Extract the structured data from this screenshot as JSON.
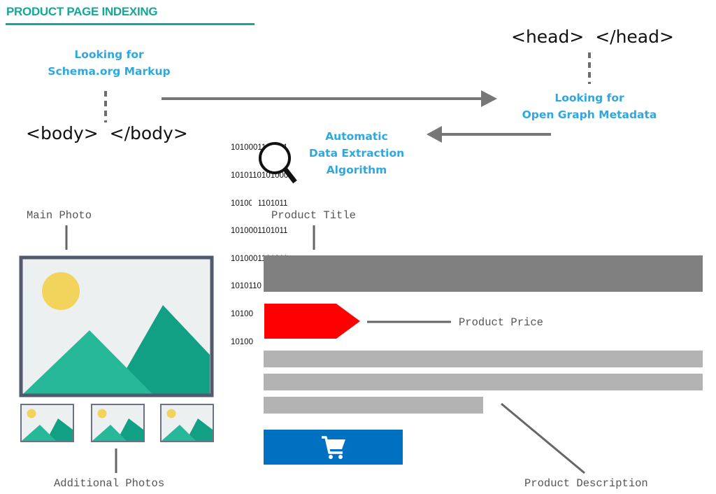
{
  "header": {
    "title": "PRODUCT PAGE INDEXING"
  },
  "labels": {
    "schema": [
      "Looking for",
      "Schema.org Markup"
    ],
    "open_graph": [
      "Looking for",
      "Open Graph Metadata"
    ],
    "algorithm": [
      "Automatic",
      "Data Extraction",
      "Algorithm"
    ]
  },
  "tags": {
    "body": "<body>  </body>",
    "head": "<head>  </head>"
  },
  "binary_lines": [
    "1010001101011",
    "1010110101000",
    "1010001101011",
    "1010001101011",
    "1010001101011",
    "1010110 1 000",
    "10100",
    "10100"
  ],
  "annotations": {
    "main_photo": "Main Photo",
    "additional_photos": "Additional Photos",
    "product_title": "Product Title",
    "product_price": "Product Price",
    "product_description": "Product Description"
  },
  "icons": {
    "magnifier": "magnifier-icon",
    "cart": "shopping-cart-icon",
    "photo": "landscape-photo-icon"
  },
  "colors": {
    "accent_teal": "#12a89a",
    "label_blue": "#2ea8df",
    "title_bar": "#808080",
    "price_tag": "#ff0000",
    "description_bar": "#b3b3b3",
    "cart_button": "#0070c0",
    "photo_frame": "#525a6e",
    "sun": "#f2d35b",
    "mountain_light": "#26b898",
    "mountain_dark": "#12a084"
  }
}
